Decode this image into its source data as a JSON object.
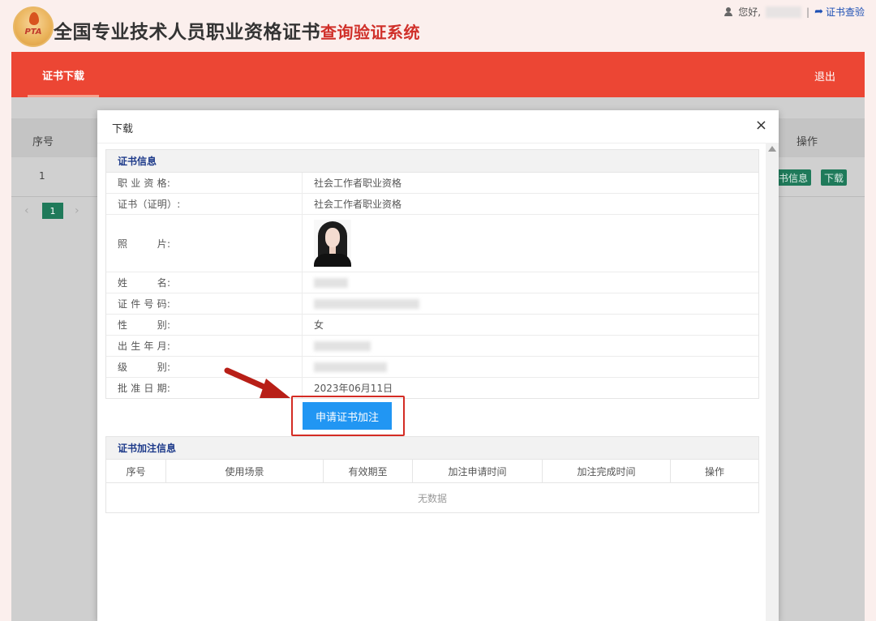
{
  "header": {
    "logo_text": "PTA",
    "title_main": "全国专业技术人员职业资格证书",
    "title_highlight": "查询验证系统",
    "greeting": "您好,",
    "separator": "|",
    "verify_link": "证书查验"
  },
  "navbar": {
    "tab_label": "证书下载",
    "logout_label": "退出"
  },
  "background_table": {
    "col_no": "序号",
    "col_op": "操作",
    "row_no": "1",
    "btn_info": "书信息",
    "btn_download": "下载",
    "pagination": {
      "prev": "‹",
      "current": "1",
      "next": "›"
    }
  },
  "modal": {
    "title": "下载",
    "close": "×",
    "cert_section": {
      "title": "证书信息",
      "rows": [
        {
          "label": "职 业 资 格:",
          "value": "社会工作者职业资格"
        },
        {
          "label": "证书（证明）:",
          "value": "社会工作者职业资格"
        },
        {
          "label": "照　　　片:",
          "value": ""
        },
        {
          "label": "姓　　　名:",
          "value": ""
        },
        {
          "label": "证 件 号 码:",
          "value": ""
        },
        {
          "label": "性　　　别:",
          "value": "女"
        },
        {
          "label": "出 生 年 月:",
          "value": ""
        },
        {
          "label": "级　　　别:",
          "value": ""
        },
        {
          "label": "批 准 日 期:",
          "value": "2023年06月11日"
        }
      ]
    },
    "apply_button": "申请证书加注",
    "annotation_section": {
      "title": "证书加注信息",
      "columns": [
        "序号",
        "使用场景",
        "有效期至",
        "加注申请时间",
        "加注完成时间",
        "操作"
      ],
      "empty_text": "无数据"
    }
  },
  "colors": {
    "nav_red": "#ec4634",
    "accent_blue": "#2196f3",
    "highlight_red": "#d42c24",
    "section_title_blue": "#1d3a8a",
    "action_green": "#1f7a5a"
  }
}
